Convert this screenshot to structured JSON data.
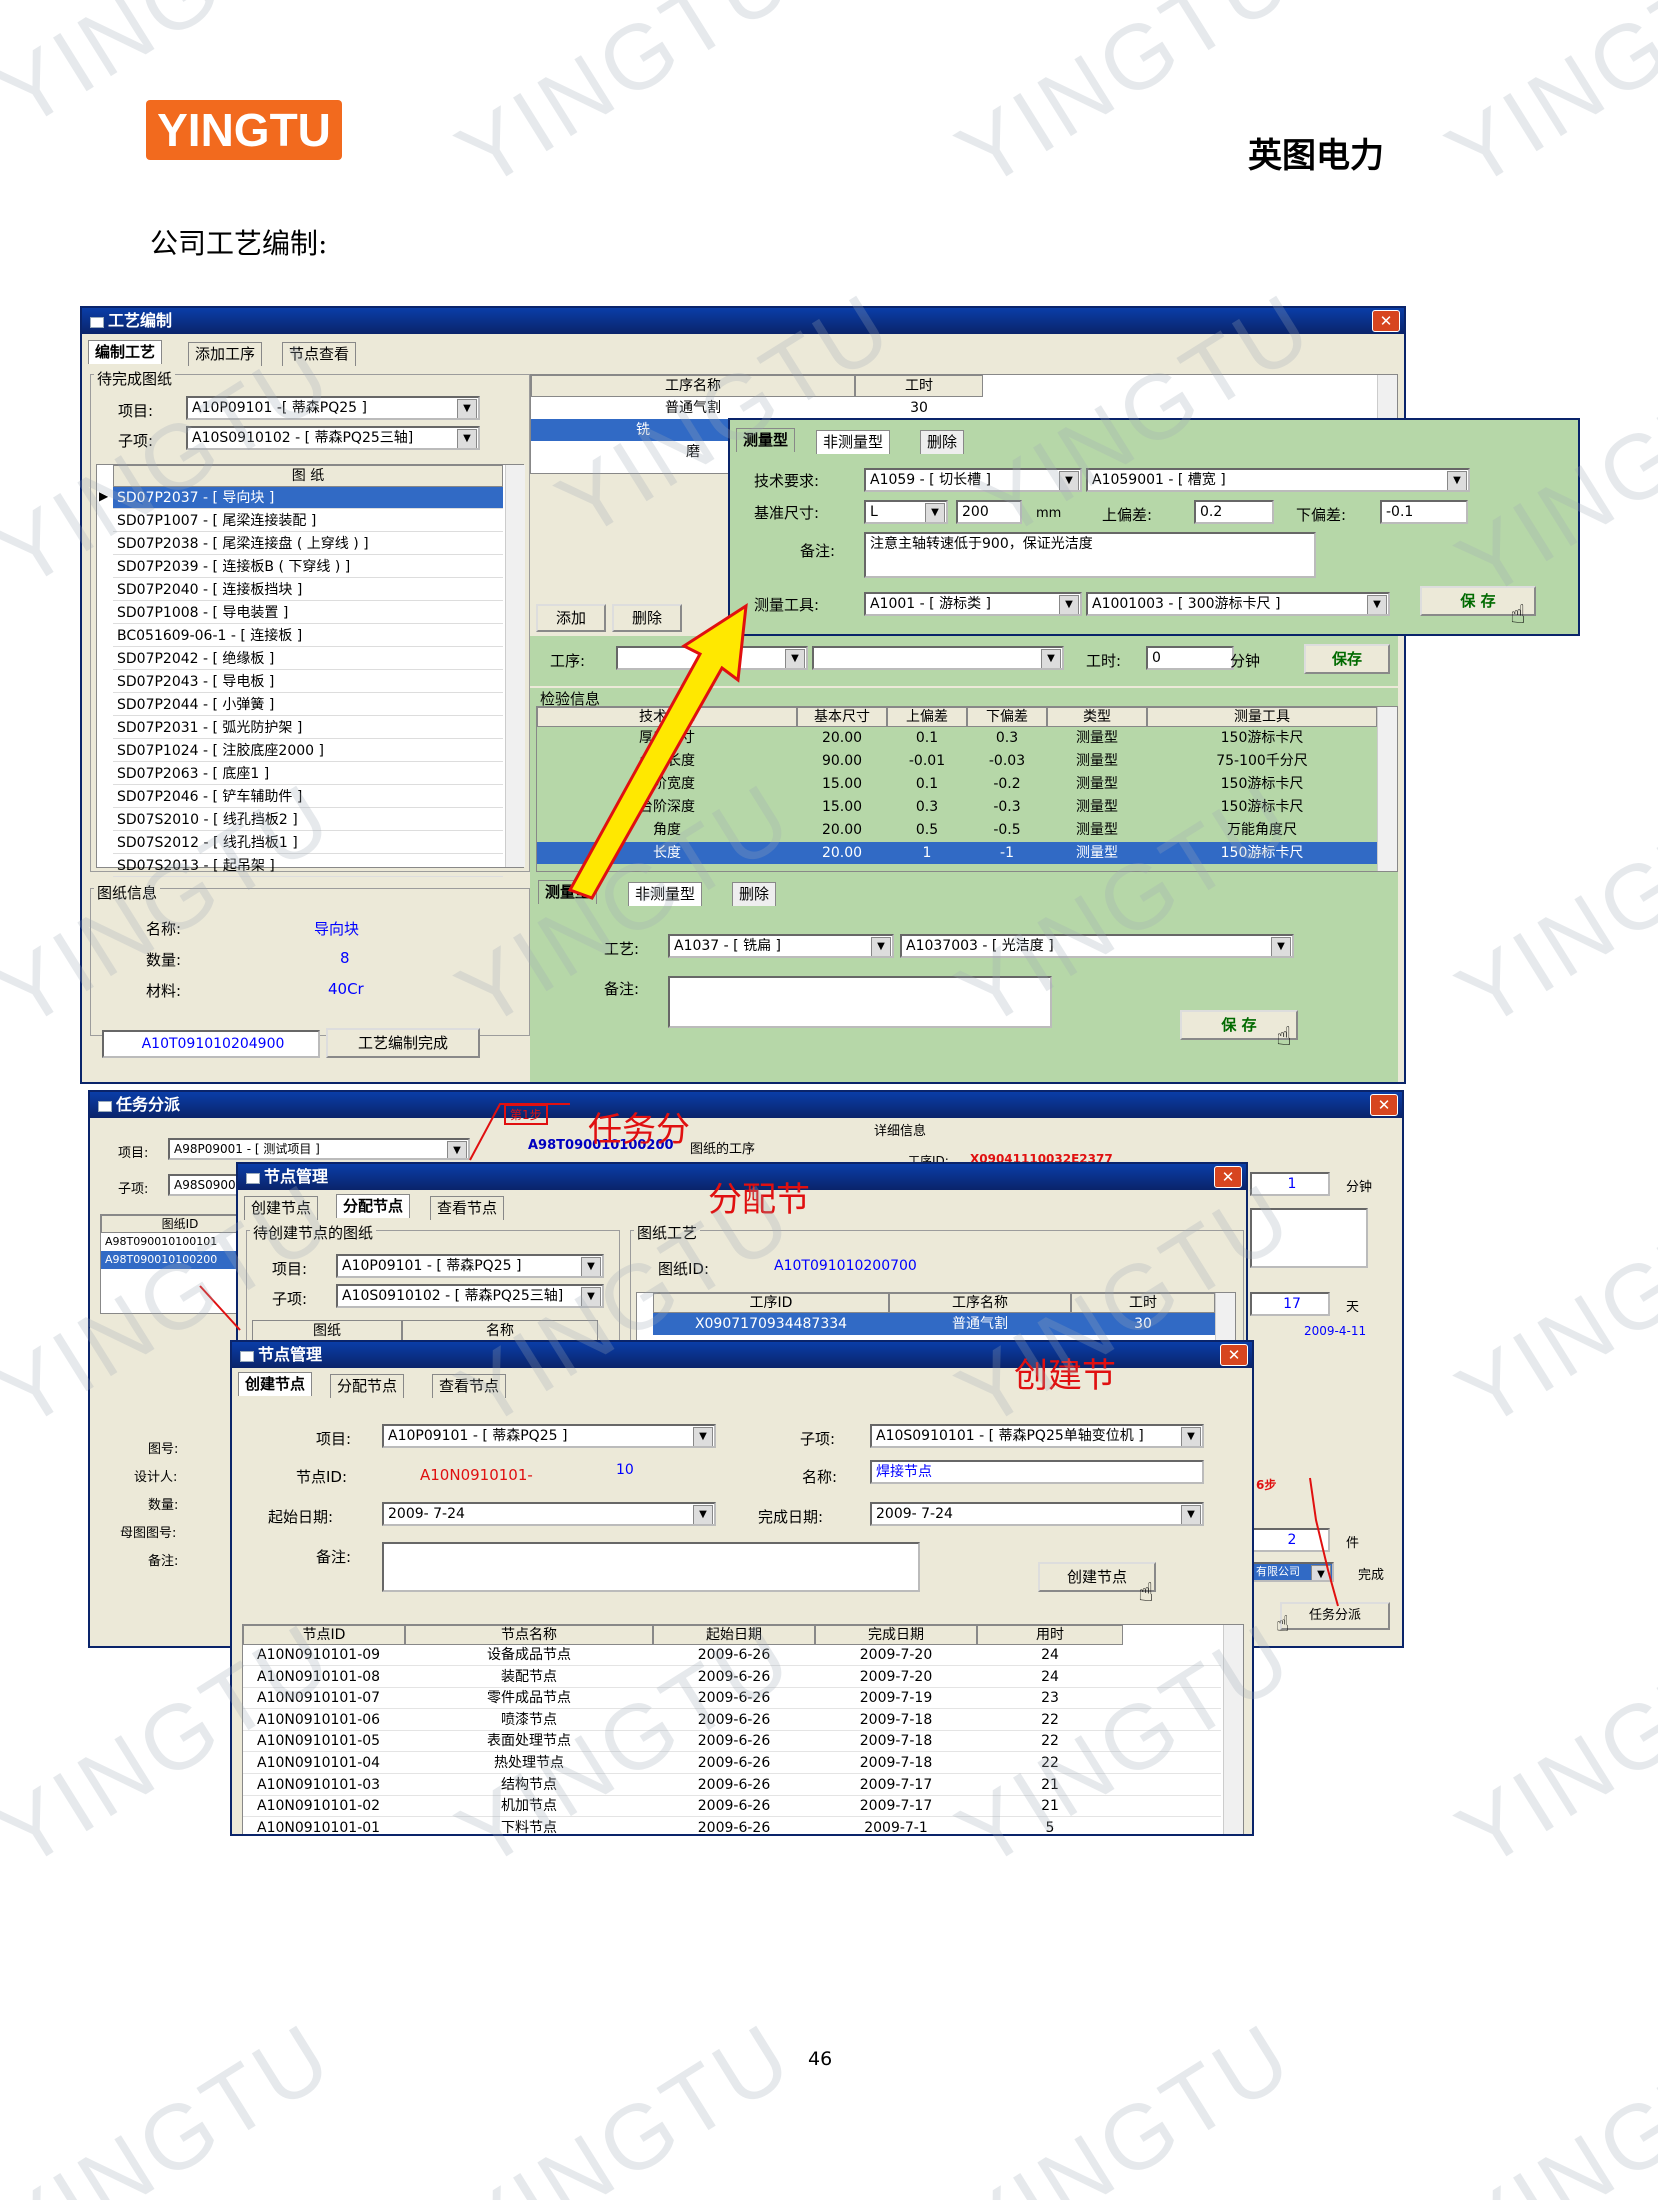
{
  "header": {
    "logo_text": "YINGTU",
    "company": "英图电力",
    "intro": "公司工艺编制:",
    "page_number": "46"
  },
  "watermark_text": "YINGTU",
  "win1": {
    "title": "工艺编制",
    "tabs": [
      "编制工艺",
      "添加工序",
      "节点查看"
    ],
    "pending_group": "待完成图纸",
    "project_label": "项目:",
    "project_value": "A10P09101 -[ 蒂森PQ25 ]",
    "subitem_label": "子项:",
    "subitem_value": "A10S0910102 - [ 蒂森PQ25三轴]",
    "drawing_header": "图    纸",
    "drawings": [
      "SD07P2037 - [ 导向块 ]",
      "SD07P1007 - [ 尾梁连接装配 ]",
      "SD07P2038 - [ 尾梁连接盘 ( 上穿线 ) ]",
      "SD07P2039 - [ 连接板B ( 下穿线 ) ]",
      "SD07P2040 - [ 连接板挡块 ]",
      "SD07P1008 - [ 导电装置 ]",
      "BC051609-06-1 - [ 连接板 ]",
      "SD07P2042 - [ 绝缘板 ]",
      "SD07P2043 - [ 导电板 ]",
      "SD07P2044 - [ 小弹簧 ]",
      "SD07P2031 - [ 弧光防护架 ]",
      "SD07P1024 - [ 注胶底座2000 ]",
      "SD07P2063 - [ 底座1 ]",
      "SD07P2046 - [ 铲车辅助件 ]",
      "SD07S2010 - [ 线孔挡板2 ]",
      "SD07S2012 - [ 线孔挡板1 ]",
      "SD07S2013 - [ 起吊架 ]"
    ],
    "info_group": "图纸信息",
    "info": [
      {
        "label": "名称:",
        "value": "导向块"
      },
      {
        "label": "数量:",
        "value": "8"
      },
      {
        "label": "材料:",
        "value": "40Cr"
      }
    ],
    "drawing_id": "A10T091010204900",
    "complete_button": "工艺编制完成",
    "process_headers": [
      "工序名称",
      "工时"
    ],
    "processes": [
      {
        "name": "普通气割",
        "hours": "30"
      },
      {
        "name": "铣",
        "hours": ""
      },
      {
        "name": "磨",
        "hours": ""
      }
    ],
    "add_button": "添加",
    "delete_button": "删除",
    "process_label": "工序:",
    "hours_label": "工时:",
    "hours_value": "0",
    "minutes_unit": "分钟",
    "save_small": "保存",
    "inspect_group": "检验信息",
    "inspect_headers": [
      "技术要求",
      "基本尺寸",
      "上偏差",
      "下偏差",
      "类型",
      "测量工具"
    ],
    "inspect_rows": [
      [
        "厚度尺寸",
        "20.00",
        "0.1",
        "0.3",
        "测量型",
        "150游标卡尺"
      ],
      [
        "台阶长度",
        "90.00",
        "-0.01",
        "-0.03",
        "测量型",
        "75-100千分尺"
      ],
      [
        "台阶宽度",
        "15.00",
        "0.1",
        "-0.2",
        "测量型",
        "150游标卡尺"
      ],
      [
        "台阶深度",
        "15.00",
        "0.3",
        "-0.3",
        "测量型",
        "150游标卡尺"
      ],
      [
        "角度",
        "20.00",
        "0.5",
        "-0.5",
        "测量型",
        "万能角度尺"
      ],
      [
        "长度",
        "20.00",
        "1",
        "-1",
        "测量型",
        "150游标卡尺"
      ]
    ],
    "lower_tabs": [
      "测量型",
      "非测量型",
      "删除"
    ],
    "craft_label": "工艺:",
    "craft_value1": "A1037 - [ 铣扁 ]",
    "craft_value2": "A1037003 - [ 光洁度 ]",
    "remark_label": "备注:",
    "save_big": "保  存"
  },
  "popup": {
    "tabs": [
      "测量型",
      "非测量型",
      "删除"
    ],
    "tech_label": "技术要求:",
    "tech_value1": "A1059 - [ 切长槽 ]",
    "tech_value2": "A1059001 - [ 槽宽 ]",
    "base_label": "基准尺寸:",
    "base_value": "L",
    "size_value": "200",
    "unit": "mm",
    "upper_label": "上偏差:",
    "upper_value": "0.2",
    "lower_label": "下偏差:",
    "lower_value": "-0.1",
    "remark_label": "备注:",
    "remark_value": "注意主轴转速低于900，保证光洁度",
    "tool_label": "测量工具:",
    "tool_value1": "A1001 - [ 游标类 ]",
    "tool_value2": "A1001003 - [ 300游标卡尺 ]",
    "save": "保  存"
  },
  "win2": {
    "title": "任务分派",
    "project_label": "项目:",
    "project_value": "A98P09001 - [ 测试项目 ]",
    "subitem_label": "子项:",
    "subitem_value": "A98S0900",
    "id_header": "图纸ID",
    "ids": [
      "A98T090010100101",
      "A98T090010100200"
    ],
    "step_badge": "第1步",
    "drawing_process": "A98T090010100200",
    "process_suffix": "图纸的工序",
    "detail_group": "详细信息",
    "detail_id_prefix": "工序ID:",
    "detail_id": "X09041110032E2377",
    "minutes_value": "1",
    "minutes_unit": "分钟",
    "days_value": "17",
    "days_unit": "天",
    "date_value": "2009-4-11",
    "left_fields": [
      "图号:",
      "设计人:",
      "数量:",
      "母图图号:",
      "备注:"
    ],
    "step6": "6步",
    "pieces_value": "2",
    "pieces_unit": "件",
    "company_value": "有限公司",
    "complete_label": "完成",
    "assign_button": "任务分派"
  },
  "win3": {
    "title": "节点管理",
    "tabs": [
      "创建节点",
      "分配节点",
      "查看节点"
    ],
    "pending_group": "待创建节点的图纸",
    "project_label": "项目:",
    "project_value": "A10P09101 - [ 蒂森PQ25 ]",
    "subitem_label": "子项:",
    "subitem_value": "A10S0910102 - [ 蒂森PQ25三轴]",
    "list_headers": [
      "图纸",
      "名称"
    ],
    "craft_group": "图纸工艺",
    "drawing_id_label": "图纸ID:",
    "drawing_id": "A10T091010200700",
    "table_headers": [
      "工序ID",
      "工序名称",
      "工时"
    ],
    "row": [
      "X0907170934487334",
      "普通气割",
      "30"
    ]
  },
  "win4": {
    "title": "节点管理",
    "tabs": [
      "创建节点",
      "分配节点",
      "查看节点"
    ],
    "project_label": "项目:",
    "project_value": "A10P09101 - [ 蒂森PQ25 ]",
    "subitem_label": "子项:",
    "subitem_value": "A10S0910101 - [ 蒂森PQ25单轴变位机 ]",
    "node_id_label": "节点ID:",
    "node_id_prefix": "A10N0910101-",
    "node_id_suffix": "10",
    "name_label": "名称:",
    "name_value": "焊接节点",
    "start_label": "起始日期:",
    "start_value": "2009- 7-24",
    "end_label": "完成日期:",
    "end_value": "2009- 7-24",
    "remark_label": "备注:",
    "create_button": "创建节点",
    "table_headers": [
      "节点ID",
      "节点名称",
      "起始日期",
      "完成日期",
      "用时"
    ],
    "rows": [
      [
        "A10N0910101-09",
        "设备成品节点",
        "2009-6-26",
        "2009-7-20",
        "24"
      ],
      [
        "A10N0910101-08",
        "装配节点",
        "2009-6-26",
        "2009-7-20",
        "24"
      ],
      [
        "A10N0910101-07",
        "零件成品节点",
        "2009-6-26",
        "2009-7-19",
        "23"
      ],
      [
        "A10N0910101-06",
        "喷漆节点",
        "2009-6-26",
        "2009-7-18",
        "22"
      ],
      [
        "A10N0910101-05",
        "表面处理节点",
        "2009-6-26",
        "2009-7-18",
        "22"
      ],
      [
        "A10N0910101-04",
        "热处理节点",
        "2009-6-26",
        "2009-7-18",
        "22"
      ],
      [
        "A10N0910101-03",
        "结构节点",
        "2009-6-26",
        "2009-7-17",
        "21"
      ],
      [
        "A10N0910101-02",
        "机加节点",
        "2009-6-26",
        "2009-7-17",
        "21"
      ],
      [
        "A10N0910101-01",
        "下料节点",
        "2009-6-26",
        "2009-7-1",
        "5"
      ]
    ]
  },
  "annotations": {
    "task": "任务分",
    "assign": "分配节",
    "create": "创建节"
  },
  "colors": {
    "selection": "#316ac5",
    "green_panel": "#b6d7a8",
    "title_bar": "#0a246a",
    "annotation": "#e01010",
    "logo": "#f26a1e"
  }
}
